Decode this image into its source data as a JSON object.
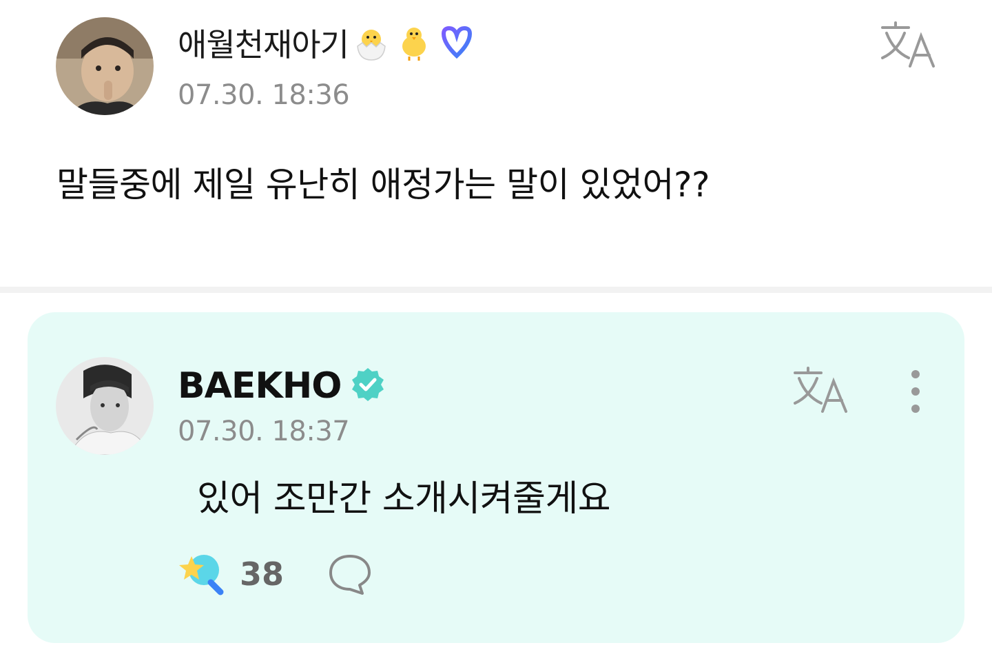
{
  "post": {
    "author": "애월천재아기",
    "badges": [
      "hatching-chick-icon",
      "baby-chick-icon",
      "weverse-membership-icon"
    ],
    "time": "07.30. 18:36",
    "text": "말들중에 제일 유난히 애정가는 말이 있었어??",
    "translate_icon": "translate-icon"
  },
  "reply": {
    "author": "BAEKHO",
    "verified_icon": "verified-icon",
    "time": "07.30. 18:37",
    "text": "있어 조만간 소개시켜줄게요",
    "like_count": "38",
    "translate_icon": "translate-icon",
    "more_icon": "more-vertical-icon",
    "comment_icon": "comment-icon"
  },
  "colors": {
    "reply_bg": "#e6fbf7",
    "verified": "#4fd1c5",
    "time": "#8c8c8c",
    "divider": "#f2f2f2"
  }
}
